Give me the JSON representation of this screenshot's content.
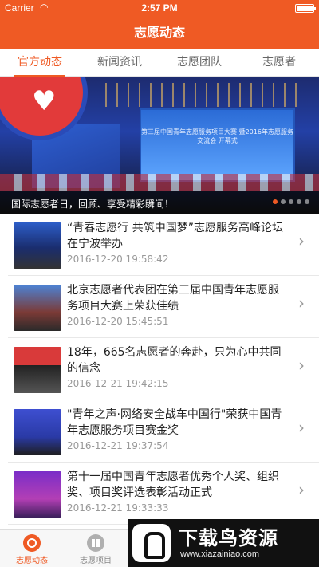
{
  "status_bar": {
    "carrier": "Carrier",
    "time": "2:57 PM"
  },
  "nav": {
    "title": "志愿动态"
  },
  "tabs": [
    {
      "label": "官方动态",
      "active": true
    },
    {
      "label": "新闻资讯",
      "active": false
    },
    {
      "label": "志愿团队",
      "active": false
    },
    {
      "label": "志愿者",
      "active": false
    }
  ],
  "banner": {
    "caption": "国际志愿者日，回顾、享受精彩瞬间！",
    "stage_text": "第三届中国青年志愿服务项目大赛 暨2016年志愿服务交流会 开幕式",
    "dots": 5,
    "active_dot": 0
  },
  "news": [
    {
      "title": "“青春志愿行 共筑中国梦”志愿服务高峰论坛在宁波举办",
      "date": "2016-12-20 19:58:42"
    },
    {
      "title": "北京志愿者代表团在第三届中国青年志愿服务项目大赛上荣获佳绩",
      "date": "2016-12-20 15:45:51"
    },
    {
      "title": "18年，665名志愿者的奔赴，只为心中共同的信念",
      "date": "2016-12-21 19:42:15"
    },
    {
      "title": "\"青年之声·网络安全战车中国行\"荣获中国青年志愿服务项目赛金奖",
      "date": "2016-12-21 19:37:54"
    },
    {
      "title": "第十一届中国青年志愿者优秀个人奖、组织奖、项目奖评选表彰活动正式",
      "date": "2016-12-21 19:33:33"
    }
  ],
  "tab_bar": [
    {
      "label": "志愿动态",
      "icon": "news-icon",
      "active": true
    },
    {
      "label": "志愿项目",
      "icon": "grid-icon",
      "active": false
    }
  ],
  "watermark": {
    "title": "下载鸟资源",
    "url": "www.xiazainiao.com"
  },
  "colors": {
    "accent": "#ef5a24"
  }
}
